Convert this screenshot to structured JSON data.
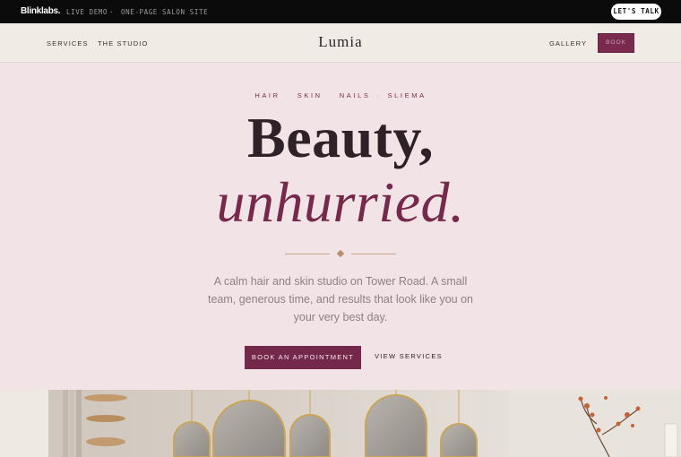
{
  "promo": {
    "logo": "Blinklabs.",
    "tag_left": "LIVE DEMO",
    "separator": "·",
    "tag_right": "ONE-PAGE SALON SITE",
    "cta": "LET'S TALK"
  },
  "nav": {
    "brand": "Lumia",
    "left_links": [
      "SERVICES",
      "THE STUDIO"
    ],
    "right_link": "GALLERY",
    "book": "BOOK"
  },
  "hero": {
    "eyebrow": [
      "HAIR",
      "SKIN",
      "NAILS",
      "SLIEMA"
    ],
    "eyebrow_separator": "·",
    "title_line1": "Beauty,",
    "title_line2": "unhurried.",
    "lede": "A calm hair and skin studio on Tower Road. A small team, generous time, and results that look like you on your very best day.",
    "primary_cta": "BOOK AN APPOINTMENT",
    "secondary_cta": "VIEW SERVICES"
  },
  "colors": {
    "accent": "#76294a",
    "hero_bg": "#f2e4e6",
    "nav_bg": "#f1ebe5",
    "promo_bg": "#0b0b0b",
    "gold": "#c8a78a"
  }
}
